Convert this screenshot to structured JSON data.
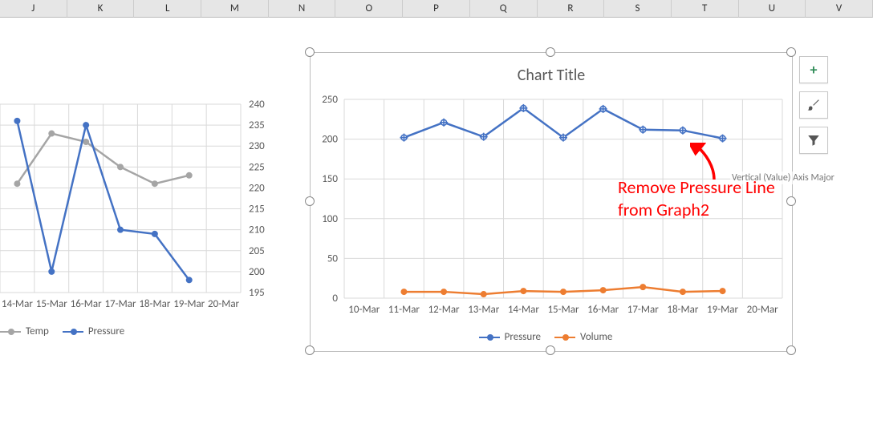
{
  "columns": [
    "J",
    "K",
    "L",
    "M",
    "N",
    "O",
    "P",
    "Q",
    "R",
    "S",
    "T",
    "U",
    "V"
  ],
  "chart_data": [
    {
      "id": "graph1",
      "type": "line",
      "title": "",
      "x_categories": [
        "14-Mar",
        "15-Mar",
        "16-Mar",
        "17-Mar",
        "18-Mar",
        "19-Mar",
        "20-Mar"
      ],
      "y_ticks": [
        195,
        200,
        205,
        210,
        215,
        220,
        225,
        230,
        235,
        240
      ],
      "ylim": [
        195,
        240
      ],
      "series": [
        {
          "name": "Temp",
          "color": "#A5A5A5",
          "values": [
            221,
            233,
            231,
            225,
            221,
            223,
            null
          ]
        },
        {
          "name": "Pressure",
          "color": "#4472C4",
          "values": [
            236,
            200,
            235,
            210,
            209,
            198,
            null
          ]
        }
      ],
      "legend": [
        "Temp",
        "Pressure"
      ]
    },
    {
      "id": "graph2",
      "type": "line",
      "title": "Chart Title",
      "selected": true,
      "x_categories": [
        "10-Mar",
        "11-Mar",
        "12-Mar",
        "13-Mar",
        "14-Mar",
        "15-Mar",
        "16-Mar",
        "17-Mar",
        "18-Mar",
        "19-Mar",
        "20-Mar"
      ],
      "y_ticks": [
        0,
        50,
        100,
        150,
        200,
        250
      ],
      "ylim": [
        0,
        250
      ],
      "series": [
        {
          "name": "Pressure",
          "color": "#4472C4",
          "selected": true,
          "values": [
            null,
            202,
            221,
            203,
            239,
            202,
            238,
            212,
            211,
            201,
            null
          ]
        },
        {
          "name": "Volume",
          "color": "#ED7D31",
          "values": [
            null,
            8,
            8,
            5,
            9,
            8,
            10,
            14,
            8,
            9,
            null
          ]
        }
      ],
      "legend": [
        "Pressure",
        "Volume"
      ]
    }
  ],
  "annotation": {
    "line1": "Remove Pressure Line",
    "line2": "from Graph2"
  },
  "tooltip": "Vertical (Value) Axis Major",
  "side_tools": {
    "add": "+",
    "style": "brush",
    "filter": "funnel"
  }
}
